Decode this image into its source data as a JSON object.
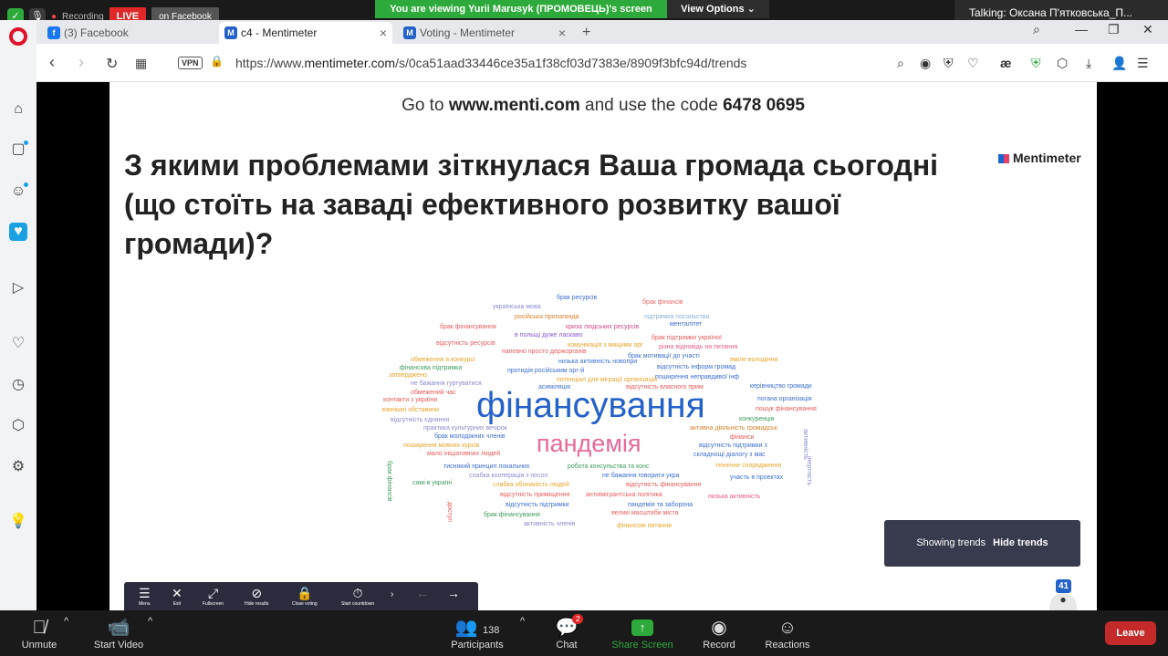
{
  "zoom": {
    "recording_text": "Recording",
    "live_label": "LIVE",
    "on_facebook": "on Facebook",
    "share_banner": "You are viewing Yurii Marusyk (ПРОМОВЕЦЬ)'s screen",
    "view_options": "View Options ⌄",
    "talking": "Talking:  Оксана  П'ятковська_П...",
    "bottom": {
      "unmute": "Unmute",
      "start_video": "Start Video",
      "participants": "Participants",
      "participants_count": "138",
      "chat": "Chat",
      "chat_badge": "2",
      "share_screen": "Share Screen",
      "record": "Record",
      "reactions": "Reactions",
      "leave": "Leave"
    }
  },
  "browser": {
    "tabs": [
      {
        "label": "(3) Facebook"
      },
      {
        "label": "c4 - Mentimeter"
      },
      {
        "label": "Voting - Mentimeter"
      }
    ],
    "vpn": "VPN",
    "url_prefix": "https://www.",
    "url_domain": "mentimeter.com",
    "url_rest": "/s/0ca51aad33446ce35a1f38cf03d7383e/8909f3bfc94d/trends"
  },
  "slide": {
    "code_text_pre": "Go to ",
    "code_site": "www.menti.com",
    "code_text_mid": " and use the code ",
    "code_number": "6478 0695",
    "question": "З якими проблемами зіткнулася Ваша громада сьогодні (що стоїть на заваді ефективного розвитку вашої громади)?",
    "brand": "Mentimeter",
    "big_word_1": "фінансування",
    "big_word_2": "пандемія",
    "words": [
      "брак ресурсів",
      "брак фінансів",
      "українська мова",
      "російська пропаганда",
      "підтримка посольства",
      "брак фінансування",
      "криза людських ресурсів",
      "менталітет",
      "в польщі дуже ласкаво",
      "відсутність ресурсів",
      "брак підтримки україної",
      "комунікація з вищими орг",
      "різна відповідь на питання",
      "напевно просто держорганів",
      "брак мотивації до участі",
      "обмеження в конкурсі",
      "низька активність новопри",
      "вміле володіння",
      "фінансова підтримка",
      "протидія російським орг-й",
      "відсутність інформ громад",
      "затверджено",
      "потенціал для міграції організацій",
      "поширення неправдивої інф",
      "не бажання гуртуватися",
      "асиміляція",
      "відсутність власного прим",
      "керівництво громади",
      "обмежений час",
      "контакти з україни",
      "погана організація",
      "зовнішні обставини",
      "пошук фінансування",
      "відсутність єднання",
      "конкуренція",
      "практика культурних вечірок",
      "активна діяльність громадськ",
      "брак молодіжних членів",
      "фінанси",
      "поширення мовних курсів",
      "відсутність підтримки з",
      "мало ініціативних людей",
      "складнощі діалогу з мас",
      "тиснякий принцип локальних",
      "робота консульства та конс",
      "технічне спорядження",
      "слабка кооперація з посол",
      "не бажання говорити укра",
      "участь в проектах",
      "самі в україні",
      "слабка обізнаність людей",
      "відсутність фінансування",
      "відсутність приміщення",
      "антиімігрантська політика",
      "низька активність",
      "відсутність підтримки",
      "пандемія та заборона",
      "брак фінансування",
      "великі масштаби міста",
      "активність членів",
      "фінансові питання",
      "брак фінансів",
      "доступ",
      "активність",
      "інертність"
    ],
    "trends_label": "Showing trends",
    "hide_trends": "Hide trends",
    "controls": [
      "Menu",
      "Exit",
      "Fullscreen",
      "Hide results",
      "Close voting",
      "Start countdown"
    ],
    "voters_badge": "41"
  },
  "colors": {
    "accent_blue": "#2461c9",
    "accent_pink": "#e8699a",
    "zoom_green": "#2eaa3c",
    "leave_red": "#c42a2a"
  }
}
